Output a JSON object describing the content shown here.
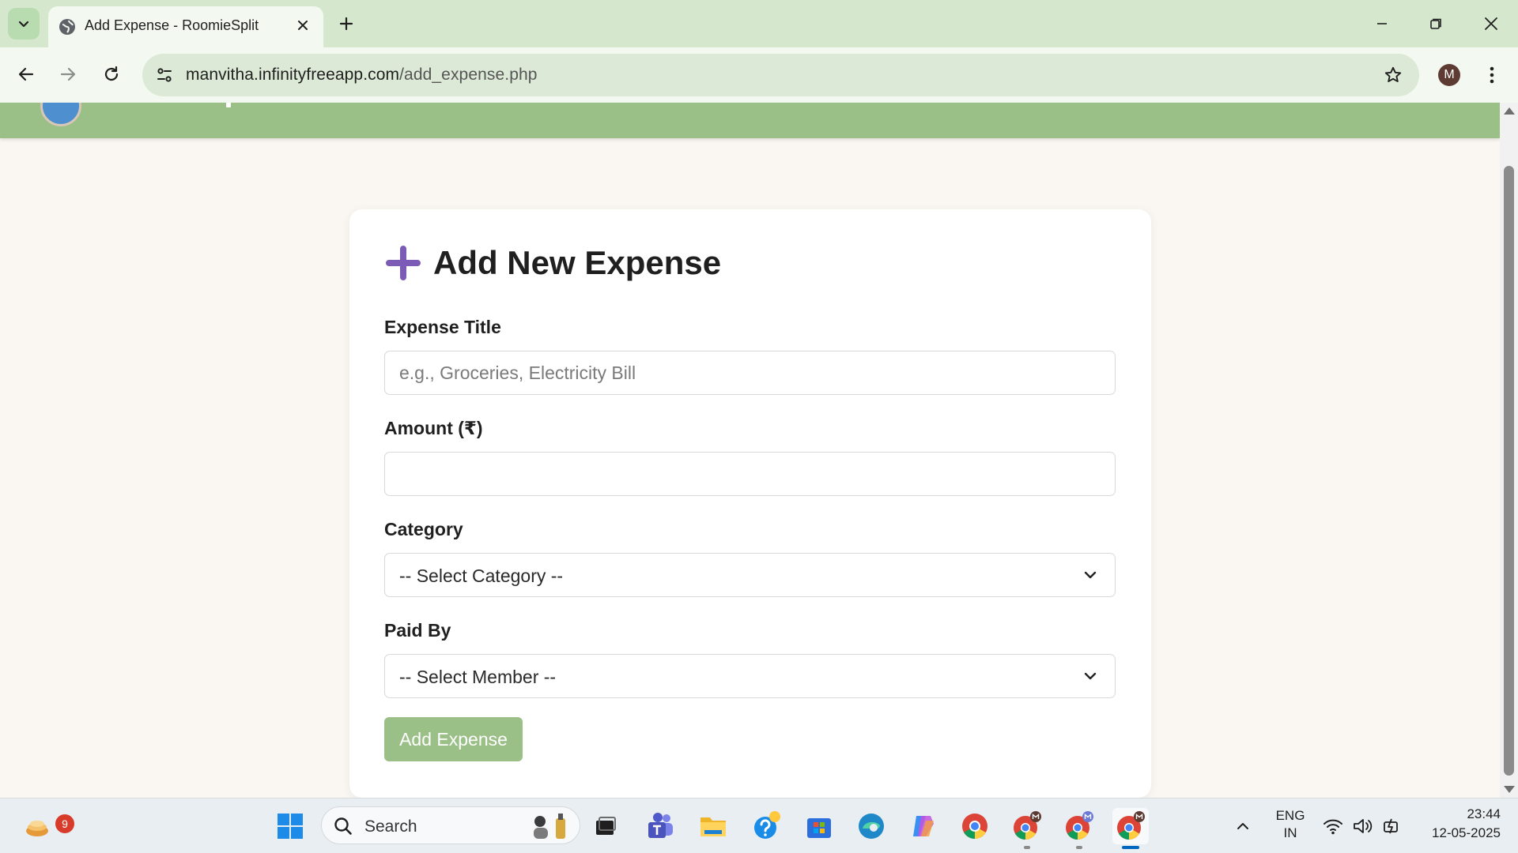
{
  "browser": {
    "tab": {
      "title": "Add Expense - RoomieSplit"
    },
    "address": {
      "domain": "manvitha.infinityfreeapp.com",
      "path": "/add_expense.php"
    },
    "profile_initial": "M"
  },
  "form": {
    "heading": "Add New Expense",
    "title_label": "Expense Title",
    "title_placeholder": "e.g., Groceries, Electricity Bill",
    "title_value": "",
    "amount_label": "Amount (₹)",
    "amount_value": "",
    "category_label": "Category",
    "category_selected": "-- Select Category --",
    "paid_by_label": "Paid By",
    "paid_by_selected": "-- Select Member --",
    "submit_label": "Add Expense"
  },
  "taskbar": {
    "widgets_badge": "9",
    "search_label": "Search",
    "language_line1": "ENG",
    "language_line2": "IN",
    "time": "23:44",
    "date": "12-05-2025"
  },
  "colors": {
    "accent_green": "#9abf87",
    "plus_icon": "#7b5bb5",
    "browser_chrome": "#d5e7cd"
  }
}
